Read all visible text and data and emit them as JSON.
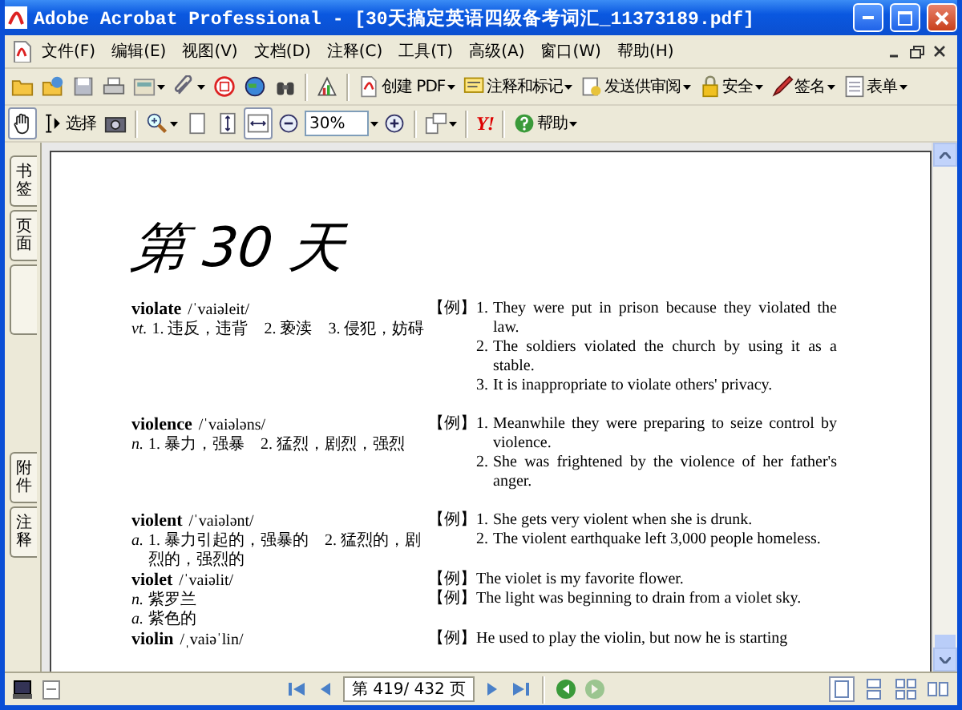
{
  "window": {
    "title": "Adobe Acrobat Professional - [30天搞定英语四级备考词汇_11373189.pdf]"
  },
  "menu": [
    "文件(F)",
    "编辑(E)",
    "视图(V)",
    "文档(D)",
    "注释(C)",
    "工具(T)",
    "高级(A)",
    "窗口(W)",
    "帮助(H)"
  ],
  "toolbar_1": [
    {
      "kind": "open"
    },
    {
      "kind": "collaborate"
    },
    {
      "kind": "save"
    },
    {
      "kind": "print"
    },
    {
      "kind": "organizer",
      "dropdown": true
    },
    {
      "kind": "attach",
      "dropdown": true
    },
    {
      "kind": "stamp"
    },
    {
      "kind": "globe"
    },
    {
      "kind": "search"
    },
    {
      "kind": "sep"
    },
    {
      "kind": "chart"
    },
    {
      "kind": "sep"
    },
    {
      "kind": "create",
      "label": "创建 PDF",
      "dropdown": true
    },
    {
      "kind": "comment",
      "label": "注释和标记",
      "dropdown": true
    },
    {
      "kind": "review",
      "label": "发送供审阅",
      "dropdown": true
    },
    {
      "kind": "lock",
      "label": "安全",
      "dropdown": true
    },
    {
      "kind": "pen",
      "label": "签名",
      "dropdown": true
    },
    {
      "kind": "form",
      "label": "表单",
      "dropdown": true
    }
  ],
  "toolbar_2": [
    {
      "kind": "hand",
      "selected": true
    },
    {
      "kind": "select",
      "label": "选择",
      "selected": false
    },
    {
      "kind": "camera",
      "selected": false
    },
    {
      "kind": "sep"
    },
    {
      "kind": "zoomin",
      "dropdown": true
    },
    {
      "kind": "page",
      "selected": false
    },
    {
      "kind": "fitheight",
      "selected": false
    },
    {
      "kind": "fitwidth",
      "selected": true
    },
    {
      "kind": "minus"
    },
    {
      "kind": "zoom",
      "value": "30%"
    },
    {
      "kind": "plus"
    },
    {
      "kind": "sep"
    },
    {
      "kind": "rotate",
      "dropdown": true
    },
    {
      "kind": "sep"
    },
    {
      "kind": "yahoo",
      "label": "Y!"
    },
    {
      "kind": "sep"
    },
    {
      "kind": "help",
      "label": "帮助",
      "dropdown": true
    }
  ],
  "side_tabs": {
    "top": [
      "书签",
      "页面"
    ],
    "bottom": [
      "附件",
      "注释"
    ]
  },
  "page": {
    "heading": "第 30 天",
    "entries": [
      {
        "word": "violate",
        "phonetic": "/ˈvaiəleit/",
        "senses": [
          {
            "pos": "vt.",
            "text": "1. 违反，违背　2. 亵渎　3. 侵犯，妨碍"
          }
        ],
        "examples": [
          {
            "label": "【例】",
            "items": [
              {
                "num": "1.",
                "text": "They were put in prison because they violated the law."
              },
              {
                "num": "2.",
                "text": "The soldiers violated the church by using it as a stable."
              },
              {
                "num": "3.",
                "text": "It is inappropriate to violate others' privacy."
              }
            ]
          }
        ],
        "gap": true
      },
      {
        "word": "violence",
        "phonetic": "/ˈvaiələns/",
        "senses": [
          {
            "pos": "n.",
            "text": "1. 暴力，强暴　2. 猛烈，剧烈，强烈"
          }
        ],
        "examples": [
          {
            "label": "【例】",
            "items": [
              {
                "num": "1.",
                "text": "Meanwhile they were preparing to seize control by violence."
              },
              {
                "num": "2.",
                "text": "She was frightened by the violence of her father's anger."
              }
            ]
          }
        ],
        "gap": true
      },
      {
        "word": "violent",
        "phonetic": "/ˈvaiələnt/",
        "senses": [
          {
            "pos": "a.",
            "text": "1. 暴力引起的，强暴的　2. 猛烈的，剧烈的，强烈的"
          }
        ],
        "examples": [
          {
            "label": "【例】",
            "items": [
              {
                "num": "1.",
                "text": "She gets very violent when she is drunk."
              },
              {
                "num": "2.",
                "text": "The violent earthquake left 3,000 people homeless."
              }
            ]
          }
        ],
        "gap": false
      },
      {
        "word": "violet",
        "phonetic": "/ˈvaiəlit/",
        "senses": [
          {
            "pos": "n.",
            "text": "紫罗兰"
          },
          {
            "pos": "a.",
            "text": "紫色的"
          }
        ],
        "examples": [
          {
            "label": "【例】",
            "items": [
              {
                "text": "The violet is my favorite flower."
              }
            ]
          },
          {
            "label": "【例】",
            "items": [
              {
                "text": "The light was beginning to drain from a violet sky."
              }
            ]
          }
        ],
        "gap": false
      },
      {
        "word": "violin",
        "phonetic": "/ˌvaiəˈlin/",
        "examples": [
          {
            "label": "【例】",
            "items": [
              {
                "text": "He used to play the violin, but now he is starting"
              }
            ]
          }
        ]
      }
    ]
  },
  "status_bar": {
    "page_field": "第 419/ 432 页",
    "back_enabled": true,
    "forward_enabled": false,
    "layouts": [
      {
        "selected": true
      },
      {
        "selected": false
      },
      {
        "selected": false
      },
      {
        "selected": false
      }
    ]
  }
}
